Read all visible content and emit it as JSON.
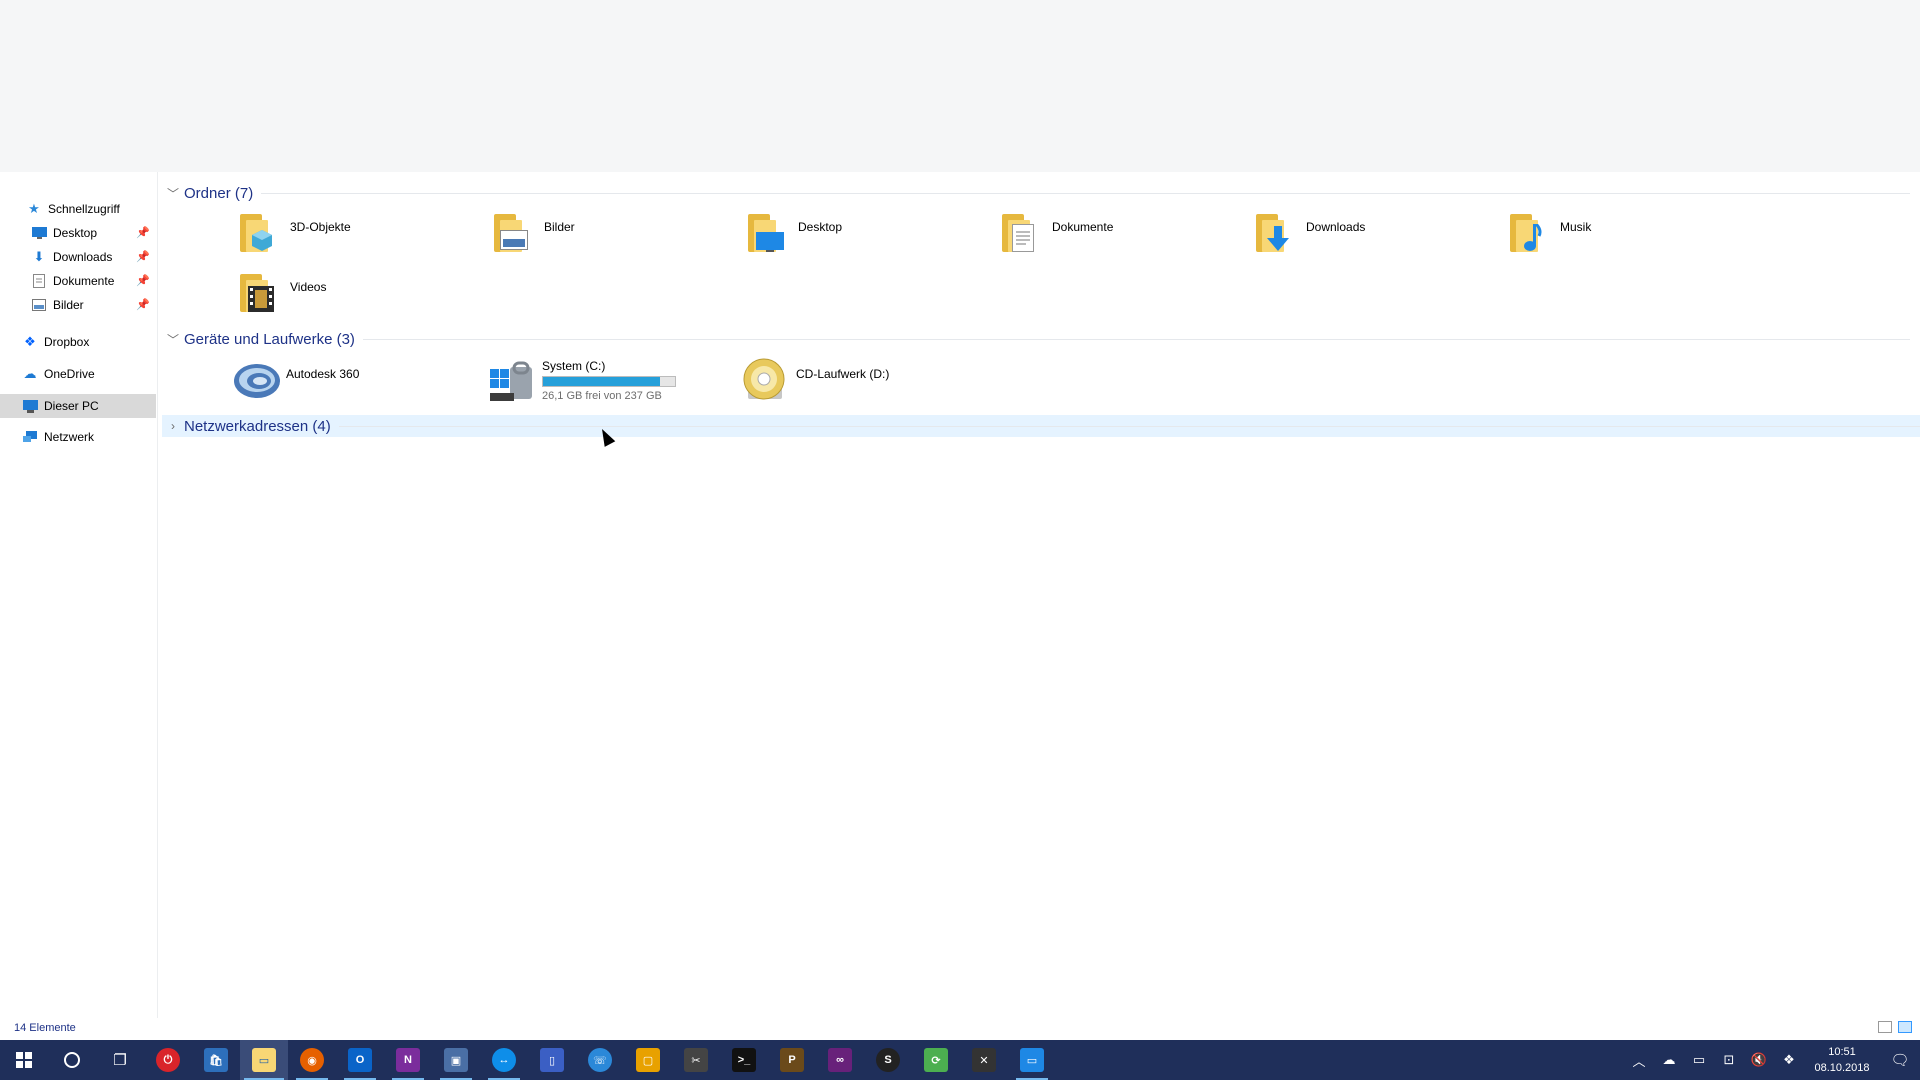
{
  "nav": {
    "items": [
      {
        "label": "Schnellzugriff",
        "icon": "star-icon",
        "indent": 0,
        "pinned": false
      },
      {
        "label": "Desktop",
        "icon": "desktop-icon",
        "indent": 1,
        "pinned": true
      },
      {
        "label": "Downloads",
        "icon": "download-arrow-icon",
        "indent": 1,
        "pinned": true
      },
      {
        "label": "Dokumente",
        "icon": "document-icon",
        "indent": 1,
        "pinned": true
      },
      {
        "label": "Bilder",
        "icon": "picture-icon",
        "indent": 1,
        "pinned": true
      },
      {
        "label": "Dropbox",
        "icon": "dropbox-icon",
        "indent": 0,
        "pinned": false
      },
      {
        "label": "OneDrive",
        "icon": "onedrive-cloud-icon",
        "indent": 0,
        "pinned": false
      },
      {
        "label": "Dieser PC",
        "icon": "computer-icon",
        "indent": 0,
        "pinned": false,
        "selected": true
      },
      {
        "label": "Netzwerk",
        "icon": "network-icon",
        "indent": 0,
        "pinned": false
      }
    ]
  },
  "groups": {
    "folders": {
      "title": "Ordner (7)"
    },
    "drives": {
      "title": "Geräte und Laufwerke (3)"
    },
    "network": {
      "title": "Netzwerkadressen (4)"
    }
  },
  "folders": [
    {
      "label": "3D-Objekte",
      "icon": "3d-objects-folder-icon"
    },
    {
      "label": "Bilder",
      "icon": "pictures-folder-icon"
    },
    {
      "label": "Desktop",
      "icon": "desktop-folder-icon"
    },
    {
      "label": "Dokumente",
      "icon": "documents-folder-icon"
    },
    {
      "label": "Downloads",
      "icon": "downloads-folder-icon"
    },
    {
      "label": "Musik",
      "icon": "music-folder-icon"
    },
    {
      "label": "Videos",
      "icon": "videos-folder-icon"
    }
  ],
  "drives": {
    "autodesk": {
      "label": "Autodesk 360",
      "icon": "autodesk-360-icon"
    },
    "system": {
      "label": "System (C:)",
      "sub": "26,1 GB frei von 237 GB",
      "used_fraction": 0.89,
      "icon": "windows-drive-icon"
    },
    "cd": {
      "label": "CD-Laufwerk (D:)",
      "icon": "cd-drive-icon"
    }
  },
  "status": {
    "items_count": "14 Elemente"
  },
  "taskbar": {
    "apps": [
      {
        "name": "start-button",
        "glyph": "⊞",
        "icon": "windows-logo-icon"
      },
      {
        "name": "cortana-button",
        "glyph": "○",
        "icon": "search-circle-icon"
      },
      {
        "name": "task-view-button",
        "glyph": "❐",
        "icon": "task-view-icon"
      }
    ],
    "clock_time": "10:51",
    "clock_date": "08.10.2018"
  },
  "colors": {
    "accent": "#26a0da",
    "taskbar": "#1f2f5a",
    "group_header_text": "#1e3287",
    "folder_yellow": "#f8d775"
  }
}
